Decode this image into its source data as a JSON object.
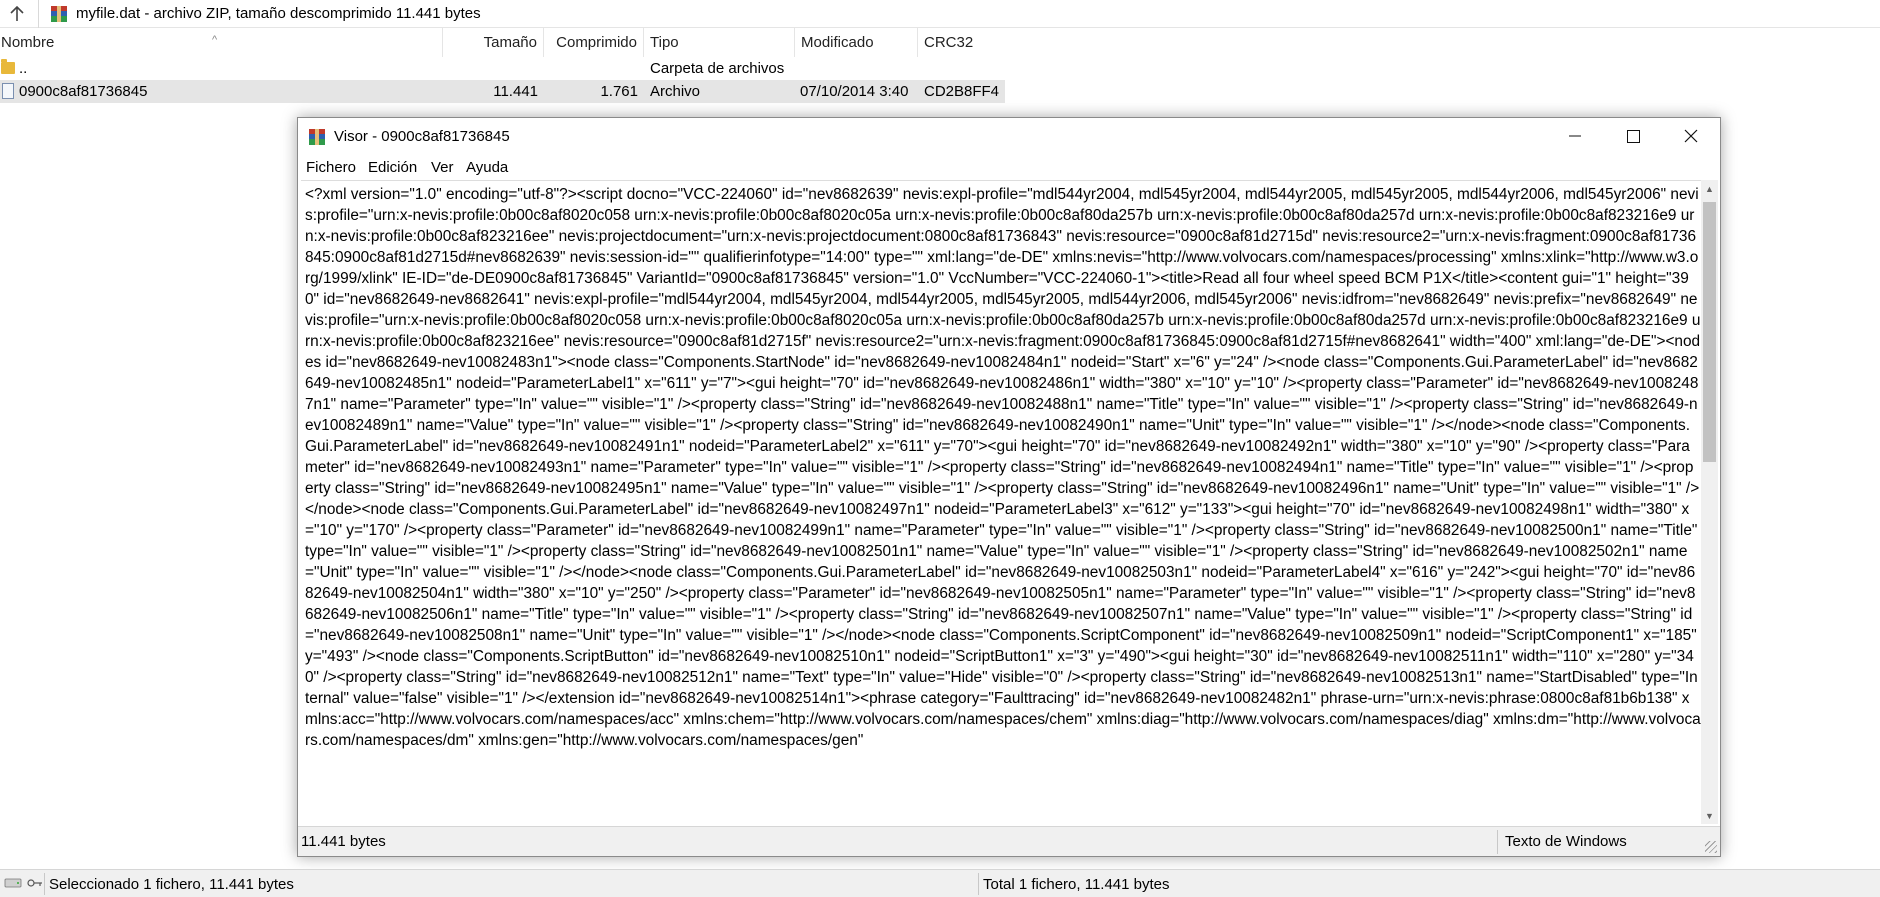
{
  "address": {
    "text": "myfile.dat - archivo ZIP, tamaño descomprimido 11.441 bytes"
  },
  "columns": {
    "name": "Nombre",
    "size": "Tamaño",
    "packed": "Comprimido",
    "type": "Tipo",
    "modified": "Modificado",
    "crc": "CRC32"
  },
  "rows": [
    {
      "name": "..",
      "size": "",
      "packed": "",
      "type": "Carpeta de archivos",
      "modified": "",
      "crc": ""
    },
    {
      "name": "0900c8af81736845",
      "size": "11.441",
      "packed": "1.761",
      "type": "Archivo",
      "modified": "07/10/2014 3:40",
      "crc": "CD2B8FF4"
    }
  ],
  "viewer": {
    "title": "Visor - 0900c8af81736845",
    "menu": [
      "Fichero",
      "Edición",
      "Ver",
      "Ayuda"
    ],
    "content": "<?xml version=\"1.0\" encoding=\"utf-8\"?><script docno=\"VCC-224060\" id=\"nev8682639\" nevis:expl-profile=\"mdl544yr2004, mdl545yr2004, mdl544yr2005, mdl545yr2005, mdl544yr2006, mdl545yr2006\" nevis:profile=\"urn:x-nevis:profile:0b00c8af8020c058 urn:x-nevis:profile:0b00c8af8020c05a urn:x-nevis:profile:0b00c8af80da257b urn:x-nevis:profile:0b00c8af80da257d urn:x-nevis:profile:0b00c8af823216e9 urn:x-nevis:profile:0b00c8af823216ee\" nevis:projectdocument=\"urn:x-nevis:projectdocument:0800c8af81736843\" nevis:resource=\"0900c8af81d2715d\" nevis:resource2=\"urn:x-nevis:fragment:0900c8af81736845:0900c8af81d2715d#nev8682639\" nevis:session-id=\"\" qualifierinfotype=\"14:00\" type=\"\" xml:lang=\"de-DE\" xmlns:nevis=\"http://www.volvocars.com/namespaces/processing\" xmlns:xlink=\"http://www.w3.org/1999/xlink\" IE-ID=\"de-DE0900c8af81736845\" VariantId=\"0900c8af81736845\" version=\"1.0\" VccNumber=\"VCC-224060-1\"><title>Read all four wheel speed BCM P1X</title><content gui=\"1\" height=\"390\" id=\"nev8682649-nev8682641\" nevis:expl-profile=\"mdl544yr2004, mdl545yr2004, mdl544yr2005, mdl545yr2005, mdl544yr2006, mdl545yr2006\" nevis:idfrom=\"nev8682649\" nevis:prefix=\"nev8682649\" nevis:profile=\"urn:x-nevis:profile:0b00c8af8020c058 urn:x-nevis:profile:0b00c8af8020c05a urn:x-nevis:profile:0b00c8af80da257b urn:x-nevis:profile:0b00c8af80da257d urn:x-nevis:profile:0b00c8af823216e9 urn:x-nevis:profile:0b00c8af823216ee\" nevis:resource=\"0900c8af81d2715f\" nevis:resource2=\"urn:x-nevis:fragment:0900c8af81736845:0900c8af81d2715f#nev8682641\" width=\"400\" xml:lang=\"de-DE\"><nodes id=\"nev8682649-nev10082483n1\"><node class=\"Components.StartNode\" id=\"nev8682649-nev10082484n1\" nodeid=\"Start\" x=\"6\" y=\"24\" /><node class=\"Components.Gui.ParameterLabel\" id=\"nev8682649-nev10082485n1\" nodeid=\"ParameterLabel1\" x=\"611\" y=\"7\"><gui height=\"70\" id=\"nev8682649-nev10082486n1\" width=\"380\" x=\"10\" y=\"10\" /><property class=\"Parameter\" id=\"nev8682649-nev10082487n1\" name=\"Parameter\" type=\"In\" value=\"\" visible=\"1\" /><property class=\"String\" id=\"nev8682649-nev10082488n1\" name=\"Title\" type=\"In\" value=\"\" visible=\"1\" /><property class=\"String\" id=\"nev8682649-nev10082489n1\" name=\"Value\" type=\"In\" value=\"\" visible=\"1\" /><property class=\"String\" id=\"nev8682649-nev10082490n1\" name=\"Unit\" type=\"In\" value=\"\" visible=\"1\" /></node><node class=\"Components.Gui.ParameterLabel\" id=\"nev8682649-nev10082491n1\" nodeid=\"ParameterLabel2\" x=\"611\" y=\"70\"><gui height=\"70\" id=\"nev8682649-nev10082492n1\" width=\"380\" x=\"10\" y=\"90\" /><property class=\"Parameter\" id=\"nev8682649-nev10082493n1\" name=\"Parameter\" type=\"In\" value=\"\" visible=\"1\" /><property class=\"String\" id=\"nev8682649-nev10082494n1\" name=\"Title\" type=\"In\" value=\"\" visible=\"1\" /><property class=\"String\" id=\"nev8682649-nev10082495n1\" name=\"Value\" type=\"In\" value=\"\" visible=\"1\" /><property class=\"String\" id=\"nev8682649-nev10082496n1\" name=\"Unit\" type=\"In\" value=\"\" visible=\"1\" /></node><node class=\"Components.Gui.ParameterLabel\" id=\"nev8682649-nev10082497n1\" nodeid=\"ParameterLabel3\" x=\"612\" y=\"133\"><gui height=\"70\" id=\"nev8682649-nev10082498n1\" width=\"380\" x=\"10\" y=\"170\" /><property class=\"Parameter\" id=\"nev8682649-nev10082499n1\" name=\"Parameter\" type=\"In\" value=\"\" visible=\"1\" /><property class=\"String\" id=\"nev8682649-nev10082500n1\" name=\"Title\" type=\"In\" value=\"\" visible=\"1\" /><property class=\"String\" id=\"nev8682649-nev10082501n1\" name=\"Value\" type=\"In\" value=\"\" visible=\"1\" /><property class=\"String\" id=\"nev8682649-nev10082502n1\" name=\"Unit\" type=\"In\" value=\"\" visible=\"1\" /></node><node class=\"Components.Gui.ParameterLabel\" id=\"nev8682649-nev10082503n1\" nodeid=\"ParameterLabel4\" x=\"616\" y=\"242\"><gui height=\"70\" id=\"nev8682649-nev10082504n1\" width=\"380\" x=\"10\" y=\"250\" /><property class=\"Parameter\" id=\"nev8682649-nev10082505n1\" name=\"Parameter\" type=\"In\" value=\"\" visible=\"1\" /><property class=\"String\" id=\"nev8682649-nev10082506n1\" name=\"Title\" type=\"In\" value=\"\" visible=\"1\" /><property class=\"String\" id=\"nev8682649-nev10082507n1\" name=\"Value\" type=\"In\" value=\"\" visible=\"1\" /><property class=\"String\" id=\"nev8682649-nev10082508n1\" name=\"Unit\" type=\"In\" value=\"\" visible=\"1\" /></node><node class=\"Components.ScriptComponent\" id=\"nev8682649-nev10082509n1\" nodeid=\"ScriptComponent1\" x=\"185\" y=\"493\" /><node class=\"Components.ScriptButton\" id=\"nev8682649-nev10082510n1\" nodeid=\"ScriptButton1\" x=\"3\" y=\"490\"><gui height=\"30\" id=\"nev8682649-nev10082511n1\" width=\"110\" x=\"280\" y=\"340\" /><property class=\"String\" id=\"nev8682649-nev10082512n1\" name=\"Text\" type=\"In\" value=\"Hide\" visible=\"0\" /><property class=\"String\" id=\"nev8682649-nev10082513n1\" name=\"StartDisabled\" type=\"Internal\" value=\"false\" visible=\"1\" /></extension id=\"nev8682649-nev10082514n1\"><phrase category=\"Faulttracing\" id=\"nev8682649-nev10082482n1\" phrase-urn=\"urn:x-nevis:phrase:0800c8af81b6b138\" xmlns:acc=\"http://www.volvocars.com/namespaces/acc\" xmlns:chem=\"http://www.volvocars.com/namespaces/chem\" xmlns:diag=\"http://www.volvocars.com/namespaces/diag\" xmlns:dm=\"http://www.volvocars.com/namespaces/dm\" xmlns:gen=\"http://www.volvocars.com/namespaces/gen\"",
    "status_left": "11.441 bytes",
    "status_right": "Texto de Windows"
  },
  "statusbar": {
    "left": "Seleccionado 1 fichero, 11.441 bytes",
    "right": "Total 1 fichero, 11.441 bytes"
  },
  "icons": {
    "up": "arrow-up-icon",
    "archive": "winrar-archive-icon",
    "folder": "folder-icon",
    "file": "file-icon"
  }
}
